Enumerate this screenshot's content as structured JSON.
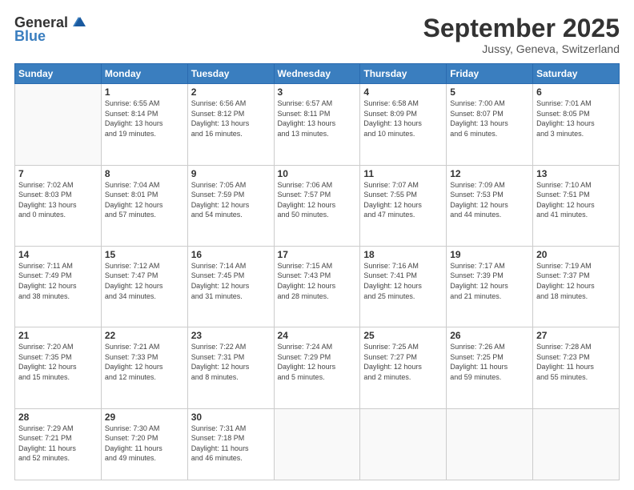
{
  "header": {
    "logo_general": "General",
    "logo_blue": "Blue",
    "month": "September 2025",
    "location": "Jussy, Geneva, Switzerland"
  },
  "weekdays": [
    "Sunday",
    "Monday",
    "Tuesday",
    "Wednesday",
    "Thursday",
    "Friday",
    "Saturday"
  ],
  "weeks": [
    [
      {
        "day": "",
        "info": ""
      },
      {
        "day": "1",
        "info": "Sunrise: 6:55 AM\nSunset: 8:14 PM\nDaylight: 13 hours\nand 19 minutes."
      },
      {
        "day": "2",
        "info": "Sunrise: 6:56 AM\nSunset: 8:12 PM\nDaylight: 13 hours\nand 16 minutes."
      },
      {
        "day": "3",
        "info": "Sunrise: 6:57 AM\nSunset: 8:11 PM\nDaylight: 13 hours\nand 13 minutes."
      },
      {
        "day": "4",
        "info": "Sunrise: 6:58 AM\nSunset: 8:09 PM\nDaylight: 13 hours\nand 10 minutes."
      },
      {
        "day": "5",
        "info": "Sunrise: 7:00 AM\nSunset: 8:07 PM\nDaylight: 13 hours\nand 6 minutes."
      },
      {
        "day": "6",
        "info": "Sunrise: 7:01 AM\nSunset: 8:05 PM\nDaylight: 13 hours\nand 3 minutes."
      }
    ],
    [
      {
        "day": "7",
        "info": "Sunrise: 7:02 AM\nSunset: 8:03 PM\nDaylight: 13 hours\nand 0 minutes."
      },
      {
        "day": "8",
        "info": "Sunrise: 7:04 AM\nSunset: 8:01 PM\nDaylight: 12 hours\nand 57 minutes."
      },
      {
        "day": "9",
        "info": "Sunrise: 7:05 AM\nSunset: 7:59 PM\nDaylight: 12 hours\nand 54 minutes."
      },
      {
        "day": "10",
        "info": "Sunrise: 7:06 AM\nSunset: 7:57 PM\nDaylight: 12 hours\nand 50 minutes."
      },
      {
        "day": "11",
        "info": "Sunrise: 7:07 AM\nSunset: 7:55 PM\nDaylight: 12 hours\nand 47 minutes."
      },
      {
        "day": "12",
        "info": "Sunrise: 7:09 AM\nSunset: 7:53 PM\nDaylight: 12 hours\nand 44 minutes."
      },
      {
        "day": "13",
        "info": "Sunrise: 7:10 AM\nSunset: 7:51 PM\nDaylight: 12 hours\nand 41 minutes."
      }
    ],
    [
      {
        "day": "14",
        "info": "Sunrise: 7:11 AM\nSunset: 7:49 PM\nDaylight: 12 hours\nand 38 minutes."
      },
      {
        "day": "15",
        "info": "Sunrise: 7:12 AM\nSunset: 7:47 PM\nDaylight: 12 hours\nand 34 minutes."
      },
      {
        "day": "16",
        "info": "Sunrise: 7:14 AM\nSunset: 7:45 PM\nDaylight: 12 hours\nand 31 minutes."
      },
      {
        "day": "17",
        "info": "Sunrise: 7:15 AM\nSunset: 7:43 PM\nDaylight: 12 hours\nand 28 minutes."
      },
      {
        "day": "18",
        "info": "Sunrise: 7:16 AM\nSunset: 7:41 PM\nDaylight: 12 hours\nand 25 minutes."
      },
      {
        "day": "19",
        "info": "Sunrise: 7:17 AM\nSunset: 7:39 PM\nDaylight: 12 hours\nand 21 minutes."
      },
      {
        "day": "20",
        "info": "Sunrise: 7:19 AM\nSunset: 7:37 PM\nDaylight: 12 hours\nand 18 minutes."
      }
    ],
    [
      {
        "day": "21",
        "info": "Sunrise: 7:20 AM\nSunset: 7:35 PM\nDaylight: 12 hours\nand 15 minutes."
      },
      {
        "day": "22",
        "info": "Sunrise: 7:21 AM\nSunset: 7:33 PM\nDaylight: 12 hours\nand 12 minutes."
      },
      {
        "day": "23",
        "info": "Sunrise: 7:22 AM\nSunset: 7:31 PM\nDaylight: 12 hours\nand 8 minutes."
      },
      {
        "day": "24",
        "info": "Sunrise: 7:24 AM\nSunset: 7:29 PM\nDaylight: 12 hours\nand 5 minutes."
      },
      {
        "day": "25",
        "info": "Sunrise: 7:25 AM\nSunset: 7:27 PM\nDaylight: 12 hours\nand 2 minutes."
      },
      {
        "day": "26",
        "info": "Sunrise: 7:26 AM\nSunset: 7:25 PM\nDaylight: 11 hours\nand 59 minutes."
      },
      {
        "day": "27",
        "info": "Sunrise: 7:28 AM\nSunset: 7:23 PM\nDaylight: 11 hours\nand 55 minutes."
      }
    ],
    [
      {
        "day": "28",
        "info": "Sunrise: 7:29 AM\nSunset: 7:21 PM\nDaylight: 11 hours\nand 52 minutes."
      },
      {
        "day": "29",
        "info": "Sunrise: 7:30 AM\nSunset: 7:20 PM\nDaylight: 11 hours\nand 49 minutes."
      },
      {
        "day": "30",
        "info": "Sunrise: 7:31 AM\nSunset: 7:18 PM\nDaylight: 11 hours\nand 46 minutes."
      },
      {
        "day": "",
        "info": ""
      },
      {
        "day": "",
        "info": ""
      },
      {
        "day": "",
        "info": ""
      },
      {
        "day": "",
        "info": ""
      }
    ]
  ]
}
